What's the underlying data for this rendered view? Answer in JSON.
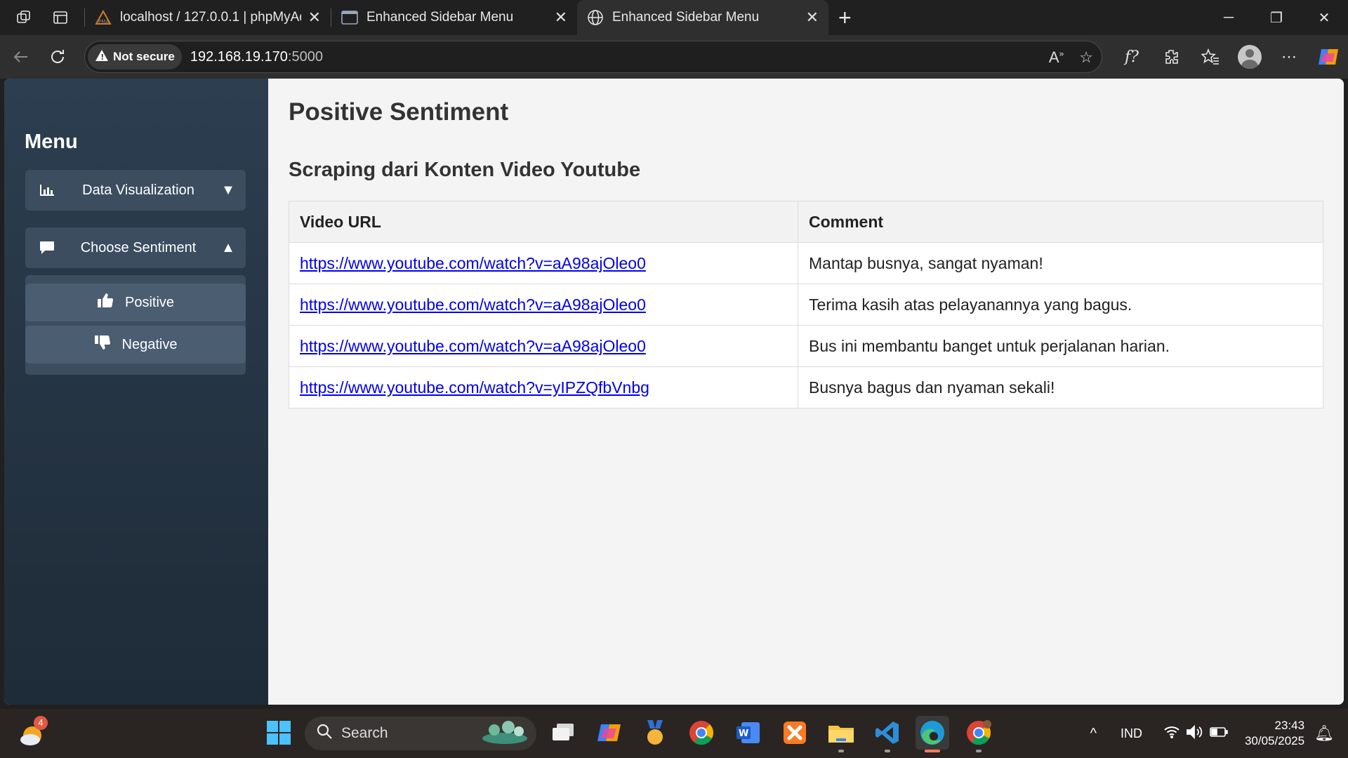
{
  "browser": {
    "tabs": [
      {
        "title": "localhost / 127.0.0.1 | phpMyAdm",
        "icon": "phpmyadmin-icon"
      },
      {
        "title": "Enhanced Sidebar Menu",
        "icon": "terminal-icon"
      },
      {
        "title": "Enhanced Sidebar Menu",
        "icon": "globe-icon",
        "active": true
      }
    ],
    "security_label": "Not secure",
    "url_host": "192.168.19.170",
    "url_port": ":5000"
  },
  "sidebar": {
    "title": "Menu",
    "menus": [
      {
        "label": "Data Visualization",
        "icon": "chart-icon",
        "caret": "▼"
      },
      {
        "label": "Choose Sentiment",
        "icon": "comment-icon",
        "caret": "▲"
      }
    ],
    "submenu": [
      {
        "label": "Positive",
        "icon": "thumbs-up-icon"
      },
      {
        "label": "Negative",
        "icon": "thumbs-down-icon"
      }
    ]
  },
  "main": {
    "title": "Positive Sentiment",
    "subtitle": "Scraping dari Konten Video Youtube",
    "table": {
      "headers": [
        "Video URL",
        "Comment"
      ],
      "rows": [
        {
          "url": "https://www.youtube.com/watch?v=aA98ajOleo0",
          "comment": "Mantap busnya, sangat nyaman!"
        },
        {
          "url": "https://www.youtube.com/watch?v=aA98ajOleo0",
          "comment": "Terima kasih atas pelayanannya yang bagus."
        },
        {
          "url": "https://www.youtube.com/watch?v=aA98ajOleo0",
          "comment": "Bus ini membantu banget untuk perjalanan harian."
        },
        {
          "url": "https://www.youtube.com/watch?v=yIPZQfbVnbg",
          "comment": "Busnya bagus dan nyaman sekali!"
        }
      ]
    }
  },
  "taskbar": {
    "search_placeholder": "Search",
    "weather_badge": "4",
    "language": "IND",
    "time": "23:43",
    "date": "30/05/2025"
  },
  "colors": {
    "sidebar_top": "#2c3e50",
    "sidebar_bottom": "#1e2b38",
    "link": "#0000ee"
  }
}
